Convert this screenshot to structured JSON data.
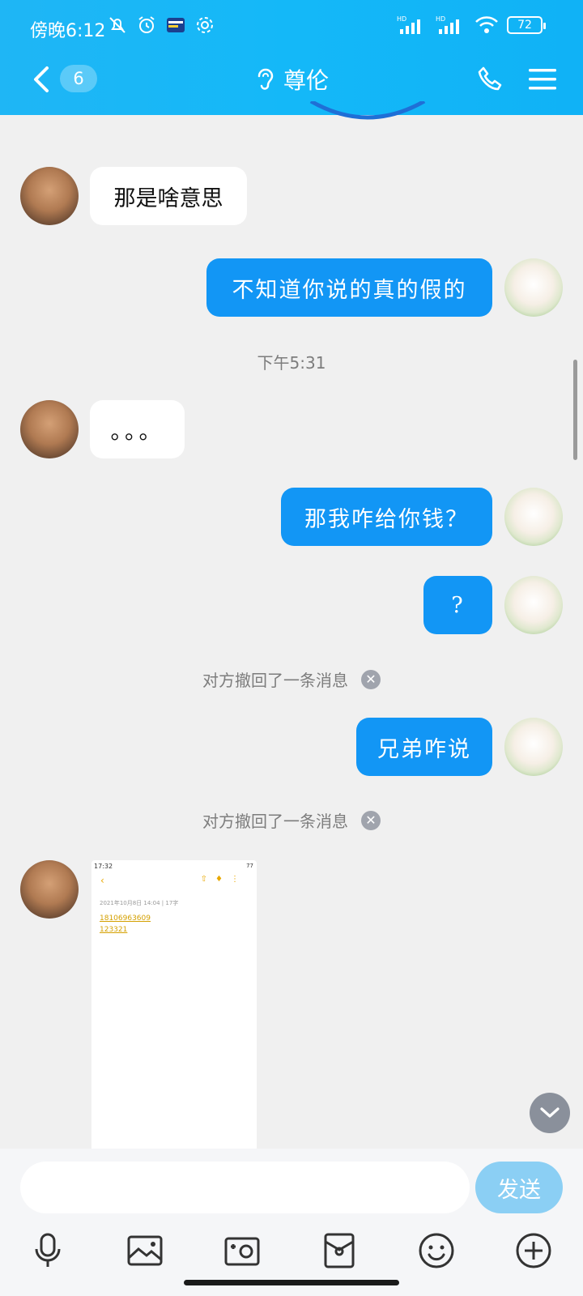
{
  "status_bar": {
    "time": "傍晚6:12",
    "network_1": "HD",
    "network_2": "HD",
    "battery": "72"
  },
  "header": {
    "unread_count": "6",
    "title": "尊伦"
  },
  "messages": [
    {
      "side": "in",
      "text": "那是啥意思"
    },
    {
      "side": "out",
      "text": "不知道你说的真的假的"
    },
    {
      "type": "time",
      "text": "下午5:31"
    },
    {
      "side": "in",
      "text": "。。。"
    },
    {
      "side": "out",
      "text": "那我咋给你钱？"
    },
    {
      "side": "out",
      "text": "?"
    },
    {
      "type": "recall",
      "text": "对方撤回了一条消息"
    },
    {
      "side": "out",
      "text": "兄弟咋说"
    },
    {
      "type": "recall",
      "text": "对方撤回了一条消息"
    }
  ],
  "screenshot_message": {
    "status_time": "17:32",
    "status_battery": "77",
    "meta": "2021年10月8日 14:04 | 17字",
    "line1": "18106963609",
    "line2": "123321"
  },
  "input": {
    "placeholder": "",
    "send_label": "发送"
  },
  "icons": {
    "tools": [
      "microphone-icon",
      "image-icon",
      "camera-icon",
      "red-packet-icon",
      "emoji-icon",
      "plus-icon"
    ]
  }
}
